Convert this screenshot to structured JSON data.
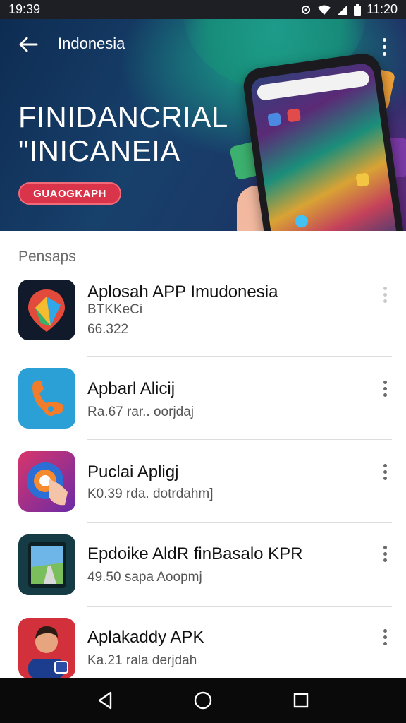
{
  "status_bar": {
    "left_time": "19:39",
    "right_time": "11:20",
    "icons": [
      "settings-gear-icon",
      "wifi-icon",
      "signal-icon",
      "battery-icon"
    ]
  },
  "header": {
    "title": "Indonesia",
    "back_icon": "arrow-left-icon",
    "overflow_icon": "more-vertical-icon"
  },
  "hero": {
    "headline_line1": "FINIDANCRIAL",
    "headline_line2": "\"INICANEIA",
    "cta_label": "GUAOGKAPH",
    "colors": {
      "cta": "#d9344a",
      "background": "#17406b"
    }
  },
  "section": {
    "label": "Pensaps"
  },
  "apps": [
    {
      "title": "Aplosah APP Imudonesia",
      "subtitle": "BTKKeCi",
      "meta": "66.322",
      "icon": "maps-pin-icon"
    },
    {
      "title": "Apbarl Alicij",
      "subtitle": "Ra.67 rar.. oorjdaj",
      "icon": "orange-phone-icon"
    },
    {
      "title": "Puclai Apligj",
      "subtitle": "K0.39 rda. dotrdahm]",
      "icon": "ring-touch-icon"
    },
    {
      "title": "Epdoike AldR finBasalo KPR",
      "subtitle": "49.50 sapa Aoopmj",
      "icon": "tablet-road-icon"
    },
    {
      "title": "Aplakaddy APK",
      "subtitle": "Ka.21 rala derjdah",
      "icon": "avatar-person-icon"
    }
  ],
  "nav_bar": {
    "icons": [
      "back-triangle-icon",
      "home-circle-icon",
      "recents-square-icon"
    ]
  }
}
